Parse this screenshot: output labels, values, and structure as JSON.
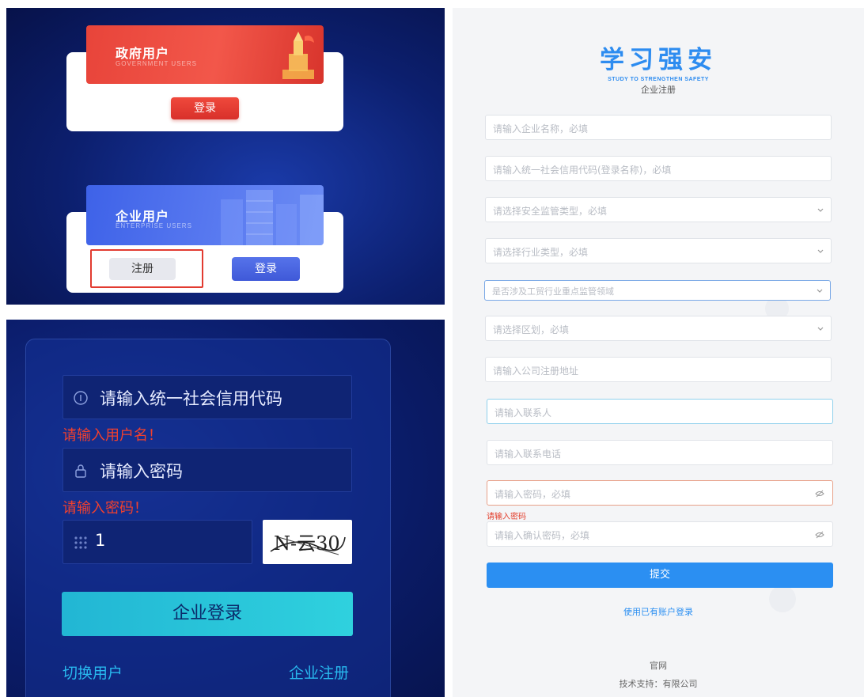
{
  "top_left": {
    "gov_title": "政府用户",
    "gov_subtitle": "GOVERNMENT USERS",
    "gov_login": "登录",
    "ent_title": "企业用户",
    "ent_subtitle": "ENTERPRISE USERS",
    "ent_register": "注册",
    "ent_login": "登录",
    "colors": {
      "gov_red": "#e8443a",
      "ent_blue": "#3e62e8",
      "highlight": "#e23b30"
    }
  },
  "login_panel": {
    "credit_code_placeholder": "请输入统一社会信用代码",
    "username_error": "请输入用户名！",
    "password_placeholder": "请输入密码",
    "password_error": "请输入密码！",
    "captcha_value": "1",
    "captcha_image_text": "N-云30",
    "login_button": "企业登录",
    "switch_user": "切换用户",
    "enterprise_register": "企业注册",
    "icons": [
      "id-icon",
      "lock-icon",
      "grid-icon"
    ]
  },
  "register_panel": {
    "brand_title": "学习强安",
    "brand_subtitle": "STUDY TO STRENGTHEN SAFETY",
    "page_subtitle": "企业注册",
    "fields": {
      "company_name": "请输入企业名称，必填",
      "credit_code": "请输入统一社会信用代码(登录名称)，必填",
      "supervision_type": "请选择安全监管类型，必填",
      "industry_type": "请选择行业类型，必填",
      "key_domain": "是否涉及工贸行业重点监管领域",
      "district": "请选择区划，必填",
      "address": "请输入公司注册地址",
      "contact": "请输入联系人",
      "phone": "请输入联系电话",
      "password": "请输入密码，必填",
      "confirm_password": "请输入确认密码，必填"
    },
    "password_error": "请输入密码",
    "submit_button": "提交",
    "existing_account_link": "使用已有账户登录",
    "footer_official": "官网",
    "footer_support": "技术支持：有限公司",
    "accent_color": "#2b8ff2"
  }
}
